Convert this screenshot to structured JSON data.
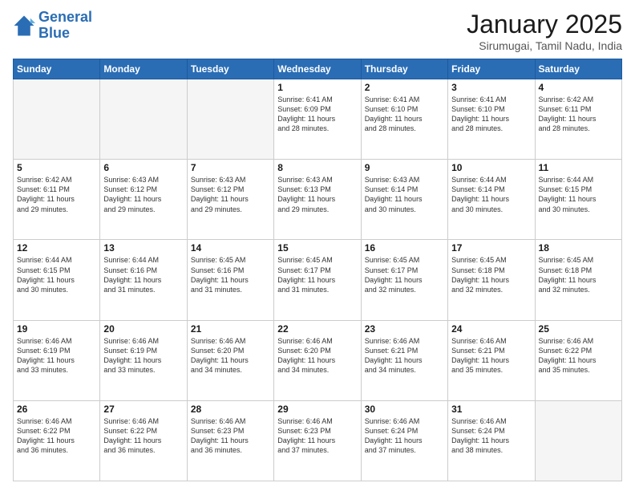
{
  "header": {
    "logo_line1": "General",
    "logo_line2": "Blue",
    "month": "January 2025",
    "location": "Sirumugai, Tamil Nadu, India"
  },
  "weekdays": [
    "Sunday",
    "Monday",
    "Tuesday",
    "Wednesday",
    "Thursday",
    "Friday",
    "Saturday"
  ],
  "weeks": [
    [
      {
        "day": "",
        "info": ""
      },
      {
        "day": "",
        "info": ""
      },
      {
        "day": "",
        "info": ""
      },
      {
        "day": "1",
        "info": "Sunrise: 6:41 AM\nSunset: 6:09 PM\nDaylight: 11 hours\nand 28 minutes."
      },
      {
        "day": "2",
        "info": "Sunrise: 6:41 AM\nSunset: 6:10 PM\nDaylight: 11 hours\nand 28 minutes."
      },
      {
        "day": "3",
        "info": "Sunrise: 6:41 AM\nSunset: 6:10 PM\nDaylight: 11 hours\nand 28 minutes."
      },
      {
        "day": "4",
        "info": "Sunrise: 6:42 AM\nSunset: 6:11 PM\nDaylight: 11 hours\nand 28 minutes."
      }
    ],
    [
      {
        "day": "5",
        "info": "Sunrise: 6:42 AM\nSunset: 6:11 PM\nDaylight: 11 hours\nand 29 minutes."
      },
      {
        "day": "6",
        "info": "Sunrise: 6:43 AM\nSunset: 6:12 PM\nDaylight: 11 hours\nand 29 minutes."
      },
      {
        "day": "7",
        "info": "Sunrise: 6:43 AM\nSunset: 6:12 PM\nDaylight: 11 hours\nand 29 minutes."
      },
      {
        "day": "8",
        "info": "Sunrise: 6:43 AM\nSunset: 6:13 PM\nDaylight: 11 hours\nand 29 minutes."
      },
      {
        "day": "9",
        "info": "Sunrise: 6:43 AM\nSunset: 6:14 PM\nDaylight: 11 hours\nand 30 minutes."
      },
      {
        "day": "10",
        "info": "Sunrise: 6:44 AM\nSunset: 6:14 PM\nDaylight: 11 hours\nand 30 minutes."
      },
      {
        "day": "11",
        "info": "Sunrise: 6:44 AM\nSunset: 6:15 PM\nDaylight: 11 hours\nand 30 minutes."
      }
    ],
    [
      {
        "day": "12",
        "info": "Sunrise: 6:44 AM\nSunset: 6:15 PM\nDaylight: 11 hours\nand 30 minutes."
      },
      {
        "day": "13",
        "info": "Sunrise: 6:44 AM\nSunset: 6:16 PM\nDaylight: 11 hours\nand 31 minutes."
      },
      {
        "day": "14",
        "info": "Sunrise: 6:45 AM\nSunset: 6:16 PM\nDaylight: 11 hours\nand 31 minutes."
      },
      {
        "day": "15",
        "info": "Sunrise: 6:45 AM\nSunset: 6:17 PM\nDaylight: 11 hours\nand 31 minutes."
      },
      {
        "day": "16",
        "info": "Sunrise: 6:45 AM\nSunset: 6:17 PM\nDaylight: 11 hours\nand 32 minutes."
      },
      {
        "day": "17",
        "info": "Sunrise: 6:45 AM\nSunset: 6:18 PM\nDaylight: 11 hours\nand 32 minutes."
      },
      {
        "day": "18",
        "info": "Sunrise: 6:45 AM\nSunset: 6:18 PM\nDaylight: 11 hours\nand 32 minutes."
      }
    ],
    [
      {
        "day": "19",
        "info": "Sunrise: 6:46 AM\nSunset: 6:19 PM\nDaylight: 11 hours\nand 33 minutes."
      },
      {
        "day": "20",
        "info": "Sunrise: 6:46 AM\nSunset: 6:19 PM\nDaylight: 11 hours\nand 33 minutes."
      },
      {
        "day": "21",
        "info": "Sunrise: 6:46 AM\nSunset: 6:20 PM\nDaylight: 11 hours\nand 34 minutes."
      },
      {
        "day": "22",
        "info": "Sunrise: 6:46 AM\nSunset: 6:20 PM\nDaylight: 11 hours\nand 34 minutes."
      },
      {
        "day": "23",
        "info": "Sunrise: 6:46 AM\nSunset: 6:21 PM\nDaylight: 11 hours\nand 34 minutes."
      },
      {
        "day": "24",
        "info": "Sunrise: 6:46 AM\nSunset: 6:21 PM\nDaylight: 11 hours\nand 35 minutes."
      },
      {
        "day": "25",
        "info": "Sunrise: 6:46 AM\nSunset: 6:22 PM\nDaylight: 11 hours\nand 35 minutes."
      }
    ],
    [
      {
        "day": "26",
        "info": "Sunrise: 6:46 AM\nSunset: 6:22 PM\nDaylight: 11 hours\nand 36 minutes."
      },
      {
        "day": "27",
        "info": "Sunrise: 6:46 AM\nSunset: 6:22 PM\nDaylight: 11 hours\nand 36 minutes."
      },
      {
        "day": "28",
        "info": "Sunrise: 6:46 AM\nSunset: 6:23 PM\nDaylight: 11 hours\nand 36 minutes."
      },
      {
        "day": "29",
        "info": "Sunrise: 6:46 AM\nSunset: 6:23 PM\nDaylight: 11 hours\nand 37 minutes."
      },
      {
        "day": "30",
        "info": "Sunrise: 6:46 AM\nSunset: 6:24 PM\nDaylight: 11 hours\nand 37 minutes."
      },
      {
        "day": "31",
        "info": "Sunrise: 6:46 AM\nSunset: 6:24 PM\nDaylight: 11 hours\nand 38 minutes."
      },
      {
        "day": "",
        "info": ""
      }
    ]
  ]
}
